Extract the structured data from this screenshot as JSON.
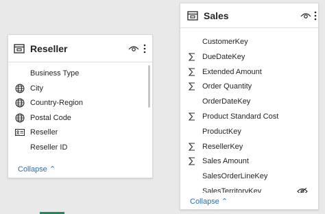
{
  "reseller": {
    "title": "Reseller",
    "fields": [
      {
        "label": "Business Type",
        "icon": ""
      },
      {
        "label": "City",
        "icon": "globe-icon"
      },
      {
        "label": "Country-Region",
        "icon": "globe-icon"
      },
      {
        "label": "Postal Code",
        "icon": "globe-icon"
      },
      {
        "label": "Reseller",
        "icon": "id-card-icon"
      },
      {
        "label": "Reseller ID",
        "icon": ""
      }
    ],
    "collapse_label": "Collapse"
  },
  "sales": {
    "title": "Sales",
    "fields": [
      {
        "label": "CustomerKey",
        "icon": ""
      },
      {
        "label": "DueDateKey",
        "icon": "sigma-icon"
      },
      {
        "label": "Extended Amount",
        "icon": "sigma-icon"
      },
      {
        "label": "Order Quantity",
        "icon": "sigma-icon"
      },
      {
        "label": "OrderDateKey",
        "icon": ""
      },
      {
        "label": "Product Standard Cost",
        "icon": "sigma-icon"
      },
      {
        "label": "ProductKey",
        "icon": ""
      },
      {
        "label": "ResellerKey",
        "icon": "sigma-icon"
      },
      {
        "label": "Sales Amount",
        "icon": "sigma-icon"
      },
      {
        "label": "SalesOrderLineKey",
        "icon": ""
      },
      {
        "label": "SalesTerritoryKey",
        "icon": "",
        "hidden": true
      }
    ],
    "collapse_label": "Collapse"
  },
  "colors": {
    "accent_link": "#2b6cb0",
    "card_bg": "#ffffff",
    "canvas_bg": "#e9e9e9"
  }
}
